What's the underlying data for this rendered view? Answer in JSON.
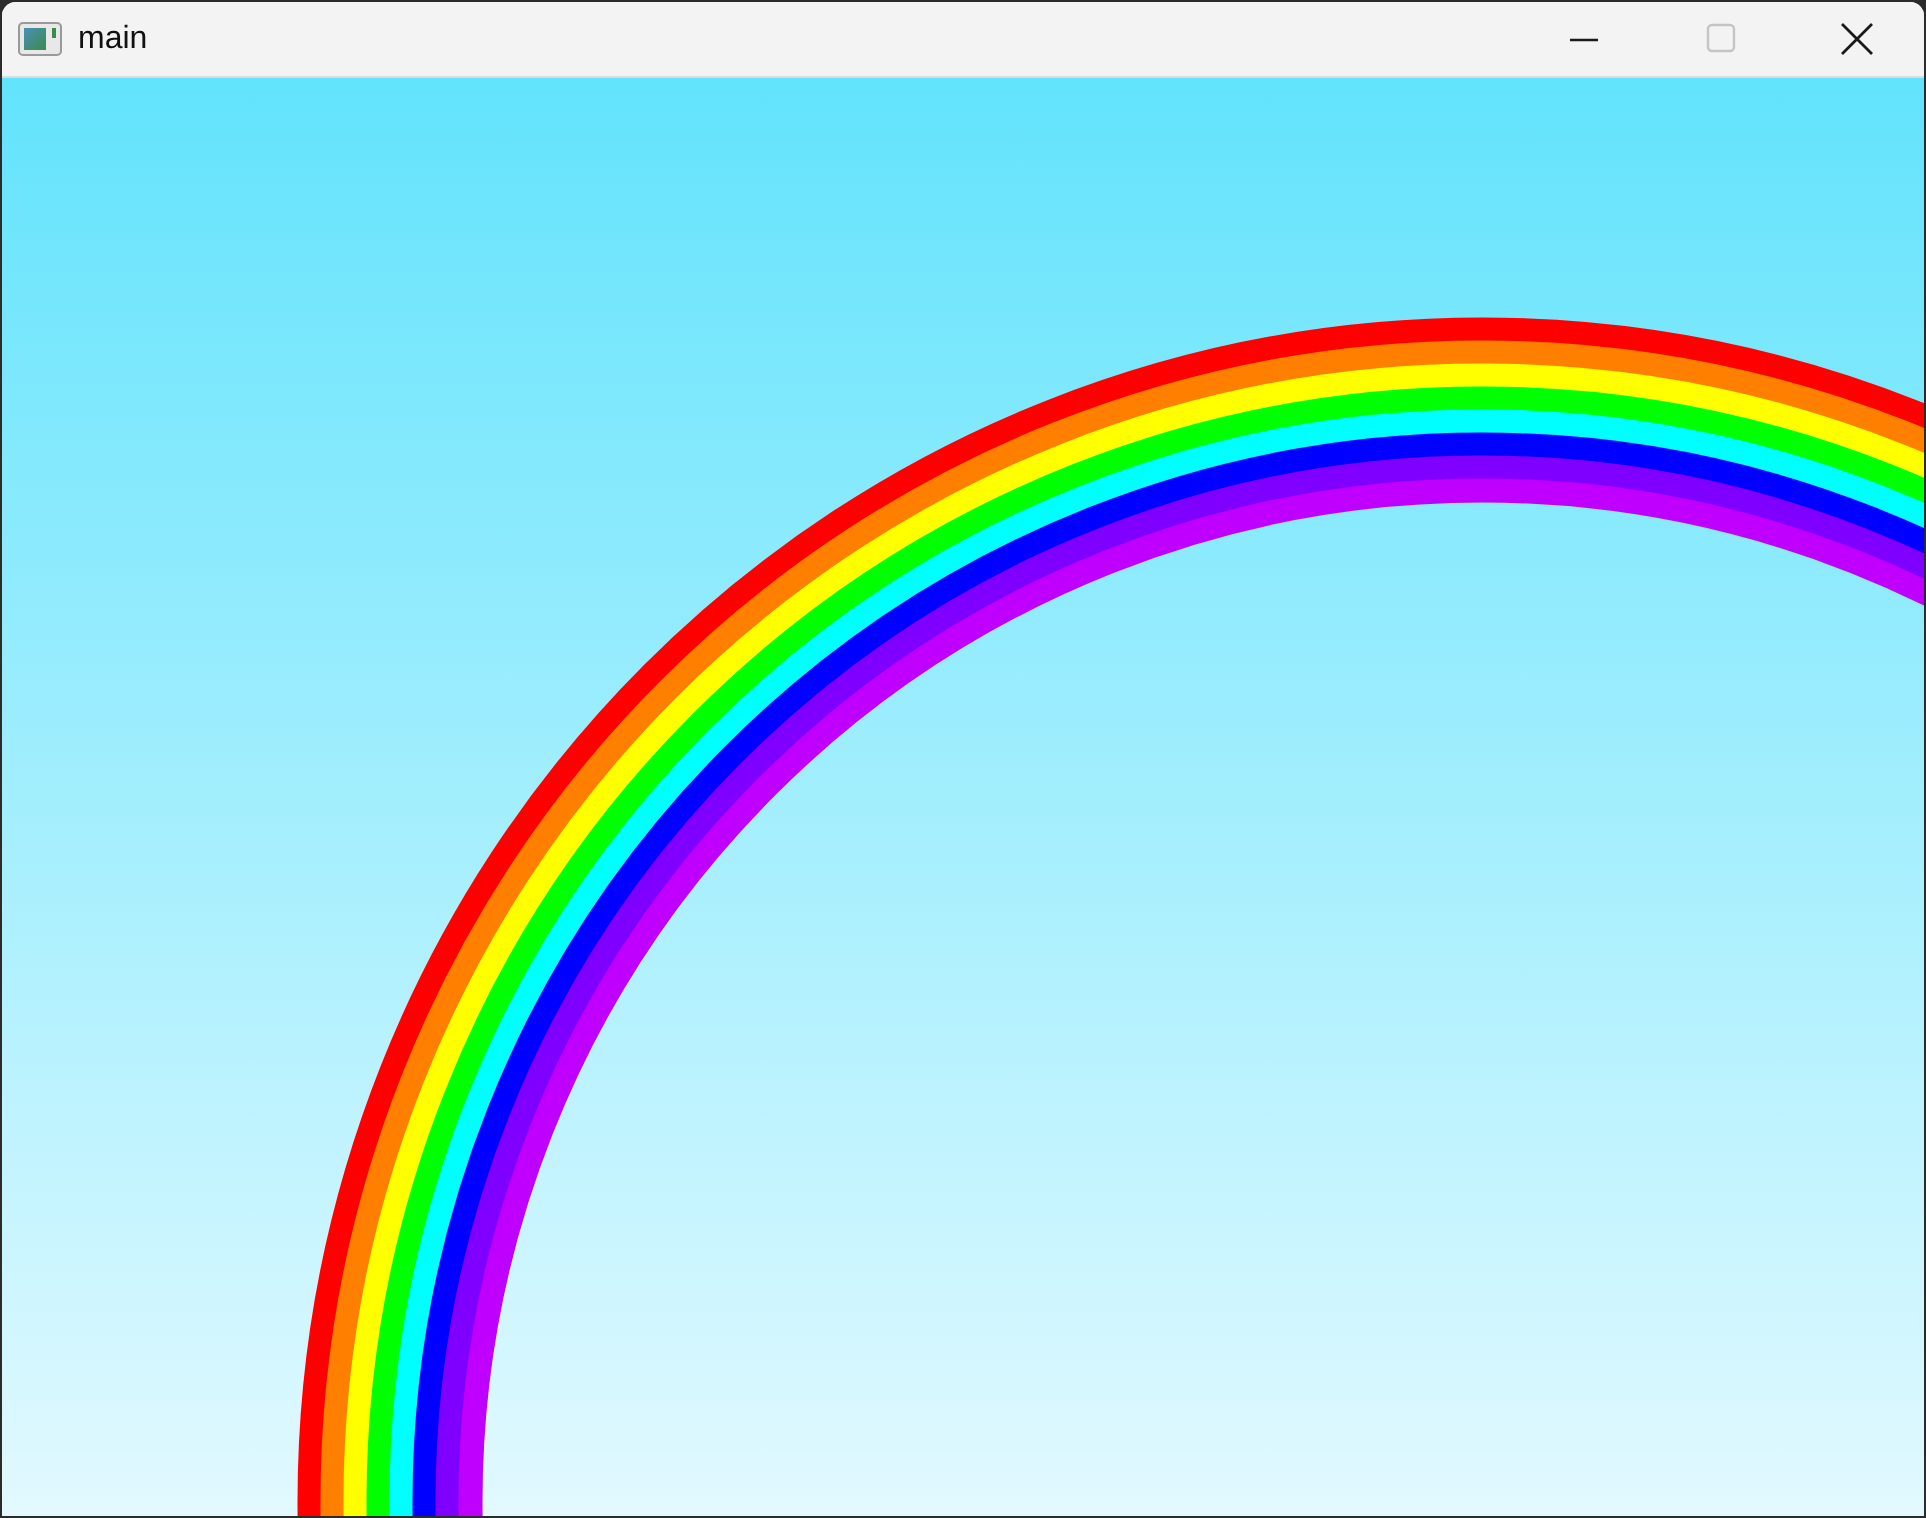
{
  "window": {
    "title": "main",
    "controls": [
      {
        "kind": "minimize",
        "disabled": false
      },
      {
        "kind": "maximize",
        "disabled": true
      },
      {
        "kind": "close",
        "disabled": false
      }
    ]
  }
}
